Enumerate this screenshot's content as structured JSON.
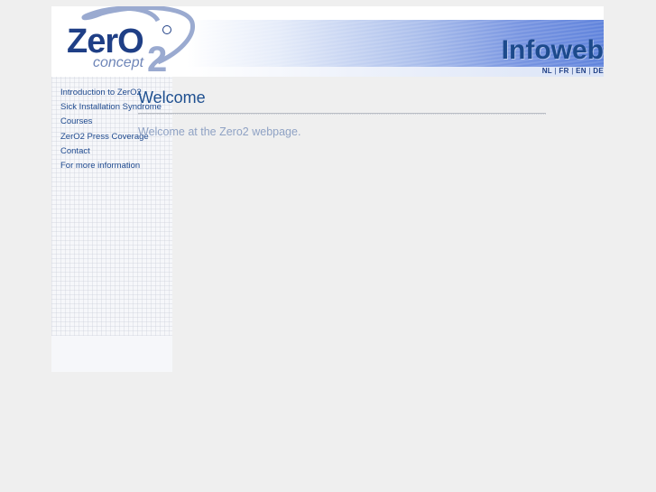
{
  "header": {
    "logo": {
      "brand": "ZerO",
      "superscript": "2",
      "tagline": "concept",
      "registered": "®"
    },
    "banner_title": "Infoweb",
    "languages": [
      "NL",
      "FR",
      "EN",
      "DE"
    ]
  },
  "sidebar": {
    "items": [
      {
        "label": "Introduction to ZerO2"
      },
      {
        "label": "Sick Installation Syndrome"
      },
      {
        "label": "Courses"
      },
      {
        "label": "ZerO2 Press Coverage"
      },
      {
        "label": "Contact"
      },
      {
        "label": "For more information"
      }
    ]
  },
  "main": {
    "title": "Welcome",
    "text": "Welcome at the Zero2 webpage."
  },
  "colors": {
    "link": "#1f4a8f",
    "title": "#1f5090",
    "body_text": "#8fa2c4",
    "banner_blue": "#5a7fdb"
  }
}
